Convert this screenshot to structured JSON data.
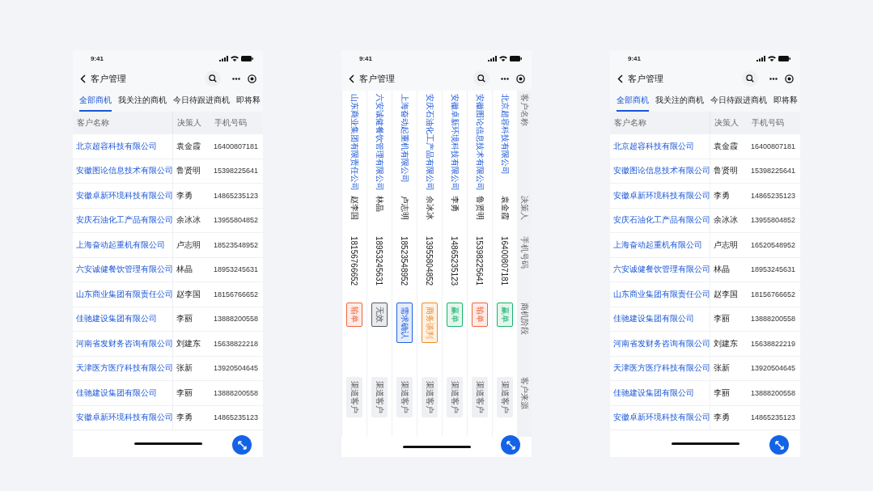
{
  "phones": [
    {
      "kind": "portrait",
      "time": "9:41",
      "title": "客户管理",
      "tabs": [
        {
          "label": "全部商机",
          "selected": true
        },
        {
          "label": "我关注的商机",
          "selected": false
        },
        {
          "label": "今日待跟进商机",
          "selected": false
        },
        {
          "label": "即将释",
          "selected": false
        }
      ],
      "columns": [
        "客户名称",
        "决策人",
        "手机号码"
      ],
      "rows": [
        {
          "company": "北京超容科技有限公司",
          "contact": "袁金霞",
          "phone": "16400807181"
        },
        {
          "company": "安徽图论信息技术有限公司",
          "contact": "鲁贤明",
          "phone": "15398225641"
        },
        {
          "company": "安徽卓新环境科技有限公司",
          "contact": "李勇",
          "phone": "14865235123"
        },
        {
          "company": "安庆石油化工产品有限公司",
          "contact": "余冰冰",
          "phone": "13955804852"
        },
        {
          "company": "上海奋动起重机有限公司",
          "contact": "卢志明",
          "phone": "18523548952"
        },
        {
          "company": "六安诚健餐饮管理有限公司",
          "contact": "林晶",
          "phone": "18953245631"
        },
        {
          "company": "山东商业集团有限责任公司",
          "contact": "赵李国",
          "phone": "18156766652"
        },
        {
          "company": "佳驰建设集团有限公司",
          "contact": "李丽",
          "phone": "13888200558"
        },
        {
          "company": "河南省发财务咨询有限公司",
          "contact": "刘建东",
          "phone": "15638822218"
        },
        {
          "company": "天津医方医疗科技有限公司",
          "contact": "张新",
          "phone": "13920504645"
        },
        {
          "company": "佳驰建设集团有限公司",
          "contact": "李丽",
          "phone": "13888200558"
        },
        {
          "company": "安徽卓新环境科技有限公司",
          "contact": "李勇",
          "phone": "14865235123"
        }
      ]
    },
    {
      "kind": "landscape",
      "time": "9:41",
      "title": "客户管理",
      "columns": [
        "客户名称",
        "决策人",
        "手机号码",
        "商机阶段",
        "客户来源"
      ],
      "rows": [
        {
          "company": "北京超容科技有限公司",
          "contact": "袁金霞",
          "phone": "16400807181",
          "stage": "赢单",
          "color": "#19b36b",
          "source": "渠道客户"
        },
        {
          "company": "安徽图论信息技术有限公司",
          "contact": "鲁贤明",
          "phone": "15398225641",
          "stage": "输单",
          "color": "#f0643c",
          "source": "渠道客户"
        },
        {
          "company": "安徽卓新环境科技有限公司",
          "contact": "李勇",
          "phone": "14865235123",
          "stage": "赢单",
          "color": "#19b36b",
          "source": "渠道客户"
        },
        {
          "company": "安庆石油化工产品有限公司",
          "contact": "余冰冰",
          "phone": "13955804852",
          "stage": "商务谈判",
          "color": "#f08c28",
          "source": "渠道客户"
        },
        {
          "company": "上海奋动起重机有限公司",
          "contact": "卢志明",
          "phone": "18523548952",
          "stage": "需求确认",
          "color": "#1f5fe0",
          "source": "渠道客户"
        },
        {
          "company": "六安诚健餐饮管理有限公司",
          "contact": "林晶",
          "phone": "18953245631",
          "stage": "无效",
          "color": "#555a66",
          "source": "渠道客户"
        },
        {
          "company": "山东商业集团有限责任公司",
          "contact": "赵李国",
          "phone": "18156766652",
          "stage": "输单",
          "color": "#f0643c",
          "source": "渠道客户"
        }
      ]
    },
    {
      "kind": "portrait",
      "time": "9:41",
      "title": "客户管理",
      "tabs": [
        {
          "label": "全部商机",
          "selected": true
        },
        {
          "label": "我关注的商机",
          "selected": false
        },
        {
          "label": "今日待跟进商机",
          "selected": false
        },
        {
          "label": "即将释",
          "selected": false
        }
      ],
      "columns": [
        "客户名称",
        "决策人",
        "手机号码"
      ],
      "rows": [
        {
          "company": "北京超容科技有限公司",
          "contact": "袁金霞",
          "phone": "16400807181"
        },
        {
          "company": "安徽图论信息技术有限公司",
          "contact": "鲁贤明",
          "phone": "15398225641"
        },
        {
          "company": "安徽卓新环境科技有限公司",
          "contact": "李勇",
          "phone": "14865235123"
        },
        {
          "company": "安庆石油化工产品有限公司",
          "contact": "余冰冰",
          "phone": "13955804852"
        },
        {
          "company": "上海奋动起重机有限公司",
          "contact": "卢志明",
          "phone": "16520548952"
        },
        {
          "company": "六安诚健餐饮管理有限公司",
          "contact": "林晶",
          "phone": "18953245631"
        },
        {
          "company": "山东商业集团有限责任公司",
          "contact": "赵李国",
          "phone": "18156766652"
        },
        {
          "company": "佳驰建设集团有限公司",
          "contact": "李丽",
          "phone": "13888200558"
        },
        {
          "company": "河南省发财务咨询有限公司",
          "contact": "刘建东",
          "phone": "15638822219"
        },
        {
          "company": "天津医方医疗科技有限公司",
          "contact": "张新",
          "phone": "13920504645"
        },
        {
          "company": "佳驰建设集团有限公司",
          "contact": "李丽",
          "phone": "13888200558"
        },
        {
          "company": "安徽卓新环境科技有限公司",
          "contact": "李勇",
          "phone": "14865235123"
        }
      ]
    }
  ]
}
